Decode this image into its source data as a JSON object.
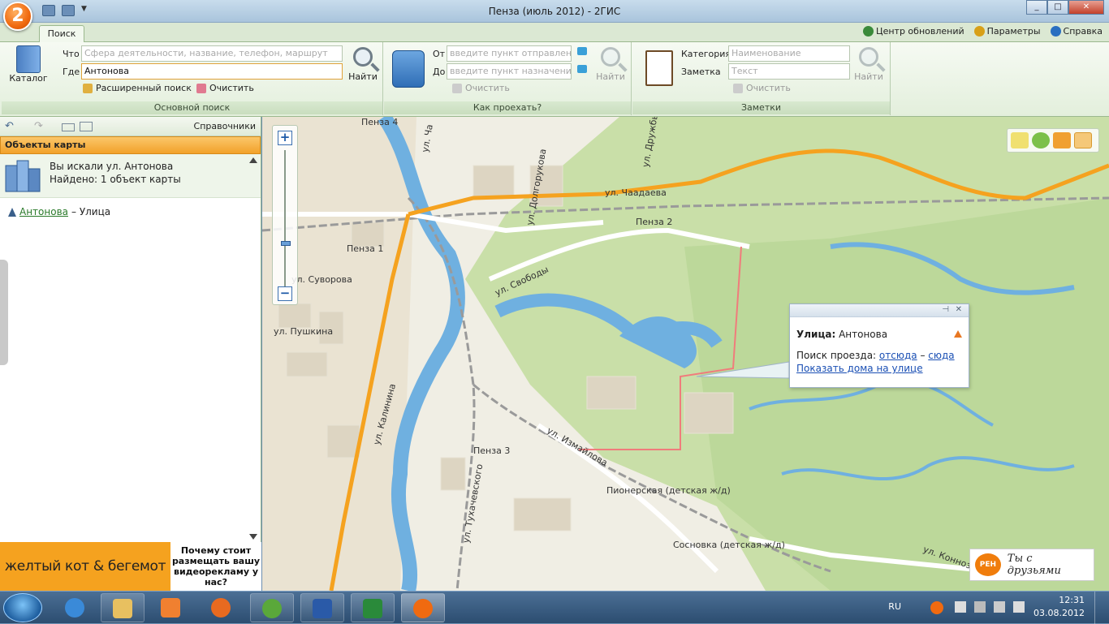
{
  "window": {
    "title": "Пенза (июль 2012) - 2ГИС",
    "logo": "2",
    "minimize": "_",
    "maximize": "□",
    "close": "✕"
  },
  "tabs": {
    "search": "Поиск"
  },
  "topright": {
    "updates": "Центр обновлений",
    "settings": "Параметры",
    "help": "Справка"
  },
  "ribbon": {
    "main": {
      "catalog": "Каталог",
      "what_label": "Что",
      "what_placeholder": "Сфера деятельности, название, телефон, маршрут",
      "where_label": "Где",
      "where_value": "Антонова",
      "find": "Найти",
      "advanced": "Расширенный поиск",
      "clear": "Очистить",
      "group_label": "Основной поиск"
    },
    "route": {
      "from_label": "От",
      "from_placeholder": "введите пункт отправления",
      "to_label": "До",
      "to_placeholder": "введите пункт назначения",
      "find": "Найти",
      "clear": "Очистить",
      "group_label": "Как проехать?"
    },
    "notes": {
      "category_label": "Категория",
      "category_placeholder": "Наименование",
      "note_label": "Заметка",
      "note_placeholder": "Текст",
      "find": "Найти",
      "clear": "Очистить",
      "group_label": "Заметки"
    }
  },
  "leftpanel": {
    "directories": "Справочники",
    "header": "Объекты карты",
    "searched": "Вы искали ул. Антонова",
    "found": "Найдено: 1 объект карты",
    "result_name": "Антонова",
    "result_type": "– Улица",
    "ad_left": "желтый кот & бегемот",
    "ad_right": "Почему стоит размещать вашу видеорекламу у нас?"
  },
  "map": {
    "labels": {
      "chaadaeva": "ул. Чаадаева",
      "penza2": "Пенза 2",
      "penza1": "Пенза 1",
      "penza3": "Пенза 3",
      "penza4": "Пенза 4",
      "svobody": "ул. Свободы",
      "suvorova": "ул. Суворова",
      "pushkina": "ул. Пушкина",
      "kalinina": "ул. Калинина",
      "izmailova": "ул. Измайлова",
      "dolgorukova": "ул. Долгорукова",
      "tukhachevskogo": "ул. Тухачевского",
      "pionerskaya": "Пионерская (детская ж/д)",
      "sosnovka": "Сосновка (детская ж/д)",
      "konnozavod": "ул. Коннозаво",
      "druzhby": "ул. Дружбы",
      "chap": "ул. Ча"
    },
    "popup": {
      "street_label": "Улица:",
      "street_name": "Антонова",
      "route_label": "Поиск проезда:",
      "from_here": "отсюда",
      "dash": "–",
      "to_here": "сюда",
      "show_houses": "Показать дома на улице"
    },
    "ren": "РЕН",
    "ren_slogan": "Ты с друзьями"
  },
  "taskbar": {
    "lang": "RU",
    "time": "12:31",
    "date": "03.08.2012"
  },
  "colors": {
    "orange_road": "#f5a21f",
    "green": "#c9dfa8",
    "water": "#6fb0e0",
    "accent": "#f06a10"
  }
}
